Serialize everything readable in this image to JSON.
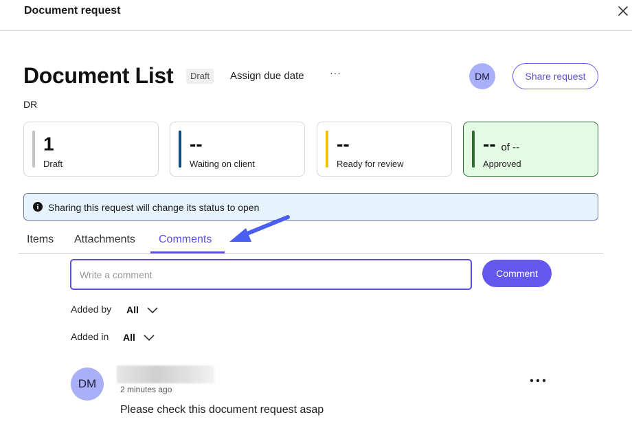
{
  "header": {
    "title": "Document request"
  },
  "document": {
    "title": "Document List",
    "status_badge": "Draft",
    "assign_due_date": "Assign due date",
    "more": "···",
    "avatar_initials": "DM",
    "share_label": "Share request",
    "subtitle": "DR"
  },
  "status_cards": [
    {
      "value": "1",
      "label": "Draft",
      "color": "#c4c4c4"
    },
    {
      "value": "--",
      "label": "Waiting on client",
      "color": "#0b4f8a"
    },
    {
      "value": "--",
      "label": "Ready for review",
      "color": "#f0c20a"
    },
    {
      "value": "--",
      "of_text": "of --",
      "label": "Approved",
      "color": "#2f6b33"
    }
  ],
  "notice": {
    "text": "Sharing this request will change its status to open"
  },
  "tabs": [
    {
      "label": "Items"
    },
    {
      "label": "Attachments"
    },
    {
      "label": "Comments",
      "active": true
    }
  ],
  "comment_form": {
    "placeholder": "Write a comment",
    "value": "",
    "submit_label": "Comment"
  },
  "filters": {
    "added_by": {
      "label": "Added by",
      "value": "All"
    },
    "added_in": {
      "label": "Added in",
      "value": "All"
    }
  },
  "comments": [
    {
      "avatar_initials": "DM",
      "time": "2 minutes ago",
      "text": "Please check this document request asap"
    }
  ],
  "colors": {
    "accent": "#5a4fe0",
    "avatar": "#a9b0f7",
    "notice_bg": "#e6f2fc",
    "approved_bg": "#e3fae3"
  }
}
